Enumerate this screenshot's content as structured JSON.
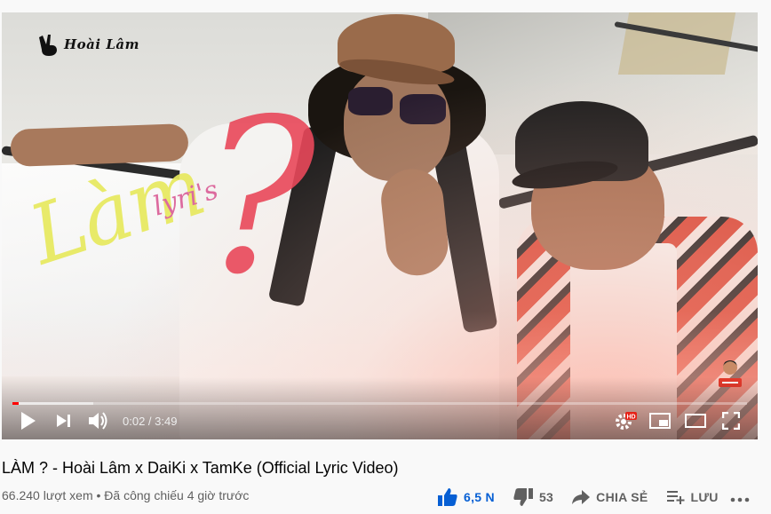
{
  "player": {
    "channel_logo_text": "Hoài Lâm",
    "overlay_title_main": "Làm",
    "overlay_title_mark": "?",
    "overlay_title_small": "lyri's",
    "current_time": "0:02",
    "time_separator": " / ",
    "duration": "3:49",
    "progress": 0.009,
    "buffered": 0.11,
    "hd_badge": "HD",
    "icons": {
      "play": "play-icon",
      "next": "next-icon",
      "volume": "volume-icon",
      "settings": "settings-gear-icon",
      "miniplayer": "miniplayer-icon",
      "theater": "theater-mode-icon",
      "fullscreen": "fullscreen-icon"
    },
    "accent_color": "#ff0000"
  },
  "video": {
    "title": "LÀM ? - Hoài Lâm x DaiKi x TamKe (Official Lyric Video)",
    "views": "66.240 lượt xem",
    "separator": " • ",
    "premiered": "Đã công chiếu 4 giờ trước"
  },
  "actions": {
    "like_count": "6,5 N",
    "dislike_count": "53",
    "share_label": "CHIA SẺ",
    "save_label": "LƯU",
    "like_color": "#065fd4"
  }
}
